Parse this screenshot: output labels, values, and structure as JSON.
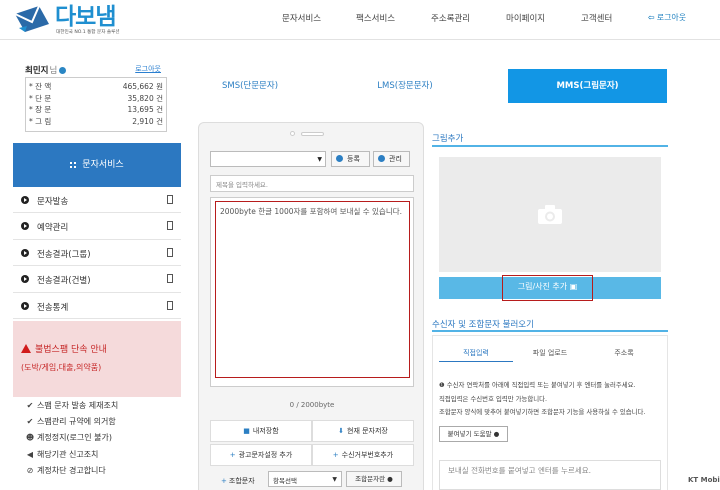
{
  "brand": {
    "name": "다보냄",
    "slogan": "대한민국 NO.1 통합 문자 솔루션"
  },
  "nav": {
    "items": [
      "문자서비스",
      "팩스서비스",
      "주소록관리",
      "마이페이지",
      "고객센터"
    ],
    "logout": "로그아웃"
  },
  "user": {
    "name": "최민지",
    "suffix": "님",
    "login_link": "로그아웃",
    "balances": [
      {
        "label": "잔  액",
        "value": "465,662 원"
      },
      {
        "label": "단  문",
        "value": "35,820 건"
      },
      {
        "label": "장  문",
        "value": "13,695 건"
      },
      {
        "label": "그  림",
        "value": "2,910 건"
      }
    ]
  },
  "sidebar": {
    "header": "문자서비스",
    "items": [
      "문자발송",
      "예약관리",
      "전송결과(그룹)",
      "전송결과(건별)",
      "전송통계"
    ],
    "alert": {
      "title": "불법스팸 단속 안내",
      "subtitle": "(도박/게임,대출,의약품)"
    },
    "links": [
      "스팸 문자 발송 제재조치",
      "스팸관리 규약에 의거함",
      "계정정지(로그인 불가)",
      "해당기관 신고조치",
      "계정차단 경고합니다"
    ]
  },
  "tabs": [
    "SMS(단문문자)",
    "LMS(장문문자)",
    "MMS(그림문자)"
  ],
  "composer": {
    "register_button": "등록",
    "manage_button": "관리",
    "title_placeholder": "제목을 입력하세요.",
    "message_placeholder": "2000byte 한글 1000자를 포함하여 보내실 수 있습니다.",
    "byte_counter": "0 / 2000byte",
    "actions": [
      "내저장함",
      "현재 문자저장",
      "광고문자설정 추가",
      "수신거부번호추가"
    ],
    "combo_label": "조합문자",
    "combo_select": "항목선택",
    "combo_button": "조합문자란"
  },
  "right": {
    "image_heading": "그림추가",
    "add_image_button": "그림/사진 추가",
    "recipients_heading": "수신자 및 조합문자 불러오기",
    "recipient_tabs": [
      "직접입력",
      "파일 업로드",
      "주소록"
    ],
    "info_lines": [
      "수신자 연락처를 아래에 직접입력 또는 붙여넣기 후 엔터를 눌러주세요.",
      "직접입력은 수신번호 입력만 가능합니다.",
      "조합문자 양식에 맞추어 붙여넣기하면 조합문자 기능을 사용하실 수 있습니다."
    ],
    "paste_help": "붙여넣기 도움말",
    "recv_placeholder": "보내실 전화번호를 붙여넣고 엔터를 누르세요."
  },
  "watermark": "KT Mobile",
  "colors": {
    "primary": "#2c78c1",
    "accent": "#1296e5",
    "alert_bg": "#f5dadb",
    "alert_text": "#c62828"
  }
}
